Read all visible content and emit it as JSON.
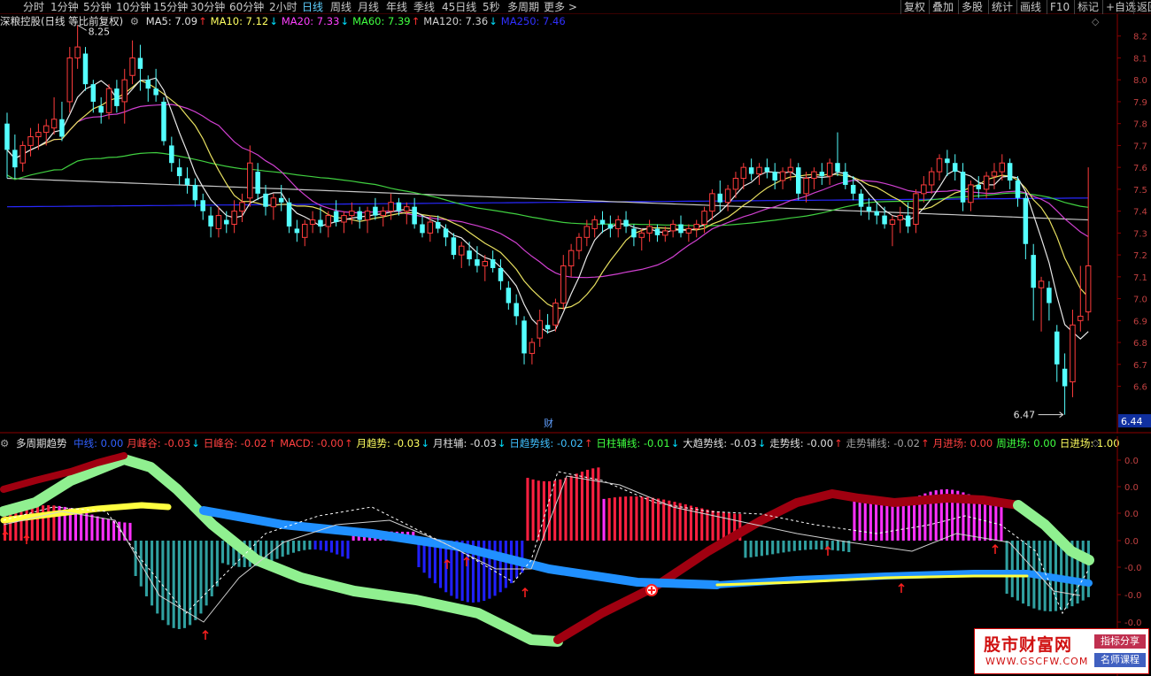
{
  "toolbar": {
    "periods": [
      "分时",
      "1分钟",
      "5分钟",
      "10分钟",
      "15分钟",
      "30分钟",
      "60分钟",
      "2小时",
      "日线",
      "周线",
      "月线",
      "年线",
      "季线",
      "45日线",
      "5秒",
      "多周期",
      "更多 >"
    ],
    "active_period": "日线",
    "right_buttons": [
      "复权",
      "叠加",
      "多股",
      "统计",
      "画线",
      "F10",
      "标记",
      "+自选",
      "返回"
    ]
  },
  "main_legend": {
    "title": "深粮控股(日线 等比前复权)",
    "items": [
      {
        "label": "MA5: 7.09",
        "arrow": "↑",
        "color": "#e0e0e0"
      },
      {
        "label": "MA10: 7.12",
        "arrow": "↓",
        "color": "#ffff60"
      },
      {
        "label": "MA20: 7.33",
        "arrow": "↓",
        "color": "#ff40ff"
      },
      {
        "label": "MA60: 7.39",
        "arrow": "↑",
        "color": "#40ff40"
      },
      {
        "label": "MA120: 7.36",
        "arrow": "↓",
        "color": "#d0d0d0"
      },
      {
        "label": "MA250: 7.46",
        "arrow": "",
        "color": "#3030ff"
      }
    ]
  },
  "price_axis": {
    "ticks": [
      "8.2",
      "8.1",
      "8.0",
      "7.9",
      "7.8",
      "7.7",
      "7.6",
      "7.5",
      "7.4",
      "7.3",
      "7.2",
      "7.1",
      "7.0",
      "6.9",
      "6.8",
      "6.7",
      "6.6"
    ],
    "current_price": "6.44",
    "high_label": "8.25",
    "low_label": "6.47",
    "marker": "财"
  },
  "indicator_legend": {
    "title": "多周期趋势",
    "items": [
      {
        "label": "中线: 0.00",
        "arrow": "",
        "color": "#3060ff"
      },
      {
        "label": "月峰谷: -0.03",
        "arrow": "↓",
        "color": "#ff4040"
      },
      {
        "label": "日峰谷: -0.02",
        "arrow": "↑",
        "color": "#ff4040"
      },
      {
        "label": "MACD: -0.00",
        "arrow": "↑",
        "color": "#ff4040"
      },
      {
        "label": "月趋势: -0.03",
        "arrow": "↓",
        "color": "#ffff60"
      },
      {
        "label": "月柱辅: -0.03",
        "arrow": "↓",
        "color": "#e0e0e0"
      },
      {
        "label": "日趋势线: -0.02",
        "arrow": "↑",
        "color": "#40c0ff"
      },
      {
        "label": "日柱辅线: -0.01",
        "arrow": "↓",
        "color": "#40ff40"
      },
      {
        "label": "大趋势线: -0.03",
        "arrow": "↓",
        "color": "#e0e0e0"
      },
      {
        "label": "走势线: -0.00",
        "arrow": "↑",
        "color": "#e0e0e0"
      },
      {
        "label": "走势辅线: -0.02",
        "arrow": "↑",
        "color": "#a0a0a0"
      },
      {
        "label": "月进场: 0.00",
        "arrow": "",
        "color": "#ff4040"
      },
      {
        "label": "周进场: 0.00",
        "arrow": "",
        "color": "#40ff40"
      },
      {
        "label": "日进场: 1.00",
        "arrow": "",
        "color": "#ffff60"
      }
    ]
  },
  "indicator_axis": {
    "ticks": [
      "0.0",
      "0.0",
      "0.0",
      "0.0",
      "-0.0",
      "-0.0",
      "-0.0",
      "-0.0"
    ]
  },
  "watermark": {
    "main": "股市财富网",
    "url": "WWW.GSCFW.COM",
    "tag1": "指标分享",
    "tag2": "名师课程"
  },
  "colors": {
    "up_candle": "#ff3c3c",
    "down_candle": "#54ffff",
    "ma5": "#e8e8e8",
    "ma10": "#e8e060",
    "ma20": "#d040d0",
    "ma60": "#40d040",
    "ma120": "#c8c8c8",
    "ma250": "#2828ff"
  },
  "chart_data": {
    "type": "candlestick",
    "ylim": [
      6.4,
      8.3
    ],
    "candles": [
      [
        7.8,
        7.85,
        7.55,
        7.68
      ],
      [
        7.68,
        7.75,
        7.55,
        7.6
      ],
      [
        7.62,
        7.72,
        7.58,
        7.7
      ],
      [
        7.7,
        7.78,
        7.65,
        7.74
      ],
      [
        7.74,
        7.8,
        7.68,
        7.76
      ],
      [
        7.76,
        7.82,
        7.7,
        7.79
      ],
      [
        7.78,
        7.92,
        7.75,
        7.82
      ],
      [
        7.82,
        7.9,
        7.72,
        7.74
      ],
      [
        7.9,
        8.15,
        7.85,
        8.1
      ],
      [
        8.1,
        8.25,
        8.05,
        8.15
      ],
      [
        8.12,
        8.15,
        7.95,
        7.98
      ],
      [
        7.98,
        8.0,
        7.85,
        7.9
      ],
      [
        7.88,
        7.92,
        7.8,
        7.85
      ],
      [
        7.85,
        7.98,
        7.82,
        7.96
      ],
      [
        7.96,
        8.0,
        7.85,
        7.88
      ],
      [
        7.9,
        8.05,
        7.8,
        8.0
      ],
      [
        8.02,
        8.18,
        7.98,
        8.1
      ],
      [
        8.1,
        8.16,
        7.95,
        8.05
      ],
      [
        8.0,
        8.02,
        7.9,
        7.96
      ],
      [
        7.96,
        8.05,
        7.9,
        7.93
      ],
      [
        7.9,
        7.92,
        7.7,
        7.72
      ],
      [
        7.7,
        7.74,
        7.58,
        7.62
      ],
      [
        7.6,
        7.64,
        7.52,
        7.56
      ],
      [
        7.55,
        7.6,
        7.48,
        7.52
      ],
      [
        7.52,
        7.55,
        7.42,
        7.45
      ],
      [
        7.45,
        7.48,
        7.36,
        7.4
      ],
      [
        7.38,
        7.42,
        7.28,
        7.33
      ],
      [
        7.32,
        7.42,
        7.28,
        7.38
      ],
      [
        7.36,
        7.4,
        7.3,
        7.34
      ],
      [
        7.34,
        7.45,
        7.3,
        7.4
      ],
      [
        7.4,
        7.48,
        7.35,
        7.44
      ],
      [
        7.46,
        7.7,
        7.42,
        7.62
      ],
      [
        7.58,
        7.62,
        7.45,
        7.48
      ],
      [
        7.48,
        7.52,
        7.38,
        7.42
      ],
      [
        7.42,
        7.48,
        7.36,
        7.46
      ],
      [
        7.46,
        7.52,
        7.4,
        7.44
      ],
      [
        7.44,
        7.46,
        7.3,
        7.33
      ],
      [
        7.32,
        7.36,
        7.26,
        7.3
      ],
      [
        7.28,
        7.36,
        7.24,
        7.34
      ],
      [
        7.34,
        7.4,
        7.3,
        7.36
      ],
      [
        7.36,
        7.42,
        7.3,
        7.33
      ],
      [
        7.33,
        7.4,
        7.28,
        7.38
      ],
      [
        7.4,
        7.45,
        7.33,
        7.35
      ],
      [
        7.35,
        7.4,
        7.3,
        7.38
      ],
      [
        7.38,
        7.44,
        7.34,
        7.4
      ],
      [
        7.4,
        7.42,
        7.32,
        7.36
      ],
      [
        7.36,
        7.42,
        7.3,
        7.4
      ],
      [
        7.42,
        7.46,
        7.36,
        7.38
      ],
      [
        7.38,
        7.42,
        7.33,
        7.4
      ],
      [
        7.4,
        7.48,
        7.36,
        7.44
      ],
      [
        7.44,
        7.46,
        7.38,
        7.4
      ],
      [
        7.4,
        7.44,
        7.34,
        7.42
      ],
      [
        7.42,
        7.46,
        7.32,
        7.34
      ],
      [
        7.34,
        7.38,
        7.28,
        7.3
      ],
      [
        7.3,
        7.38,
        7.26,
        7.35
      ],
      [
        7.35,
        7.38,
        7.3,
        7.32
      ],
      [
        7.32,
        7.34,
        7.24,
        7.28
      ],
      [
        7.28,
        7.3,
        7.18,
        7.2
      ],
      [
        7.2,
        7.26,
        7.14,
        7.24
      ],
      [
        7.22,
        7.26,
        7.15,
        7.18
      ],
      [
        7.18,
        7.24,
        7.12,
        7.15
      ],
      [
        7.15,
        7.2,
        7.08,
        7.17
      ],
      [
        7.18,
        7.22,
        7.12,
        7.14
      ],
      [
        7.14,
        7.18,
        7.04,
        7.08
      ],
      [
        7.05,
        7.08,
        6.95,
        6.98
      ],
      [
        6.98,
        7.02,
        6.88,
        6.92
      ],
      [
        6.9,
        6.92,
        6.7,
        6.75
      ],
      [
        6.75,
        6.82,
        6.7,
        6.8
      ],
      [
        6.82,
        6.95,
        6.78,
        6.9
      ],
      [
        6.88,
        6.93,
        6.84,
        6.86
      ],
      [
        6.88,
        7.0,
        6.85,
        6.98
      ],
      [
        6.98,
        7.2,
        6.95,
        7.15
      ],
      [
        7.15,
        7.25,
        7.1,
        7.22
      ],
      [
        7.22,
        7.3,
        7.18,
        7.28
      ],
      [
        7.28,
        7.36,
        7.24,
        7.33
      ],
      [
        7.32,
        7.38,
        7.28,
        7.36
      ],
      [
        7.36,
        7.4,
        7.3,
        7.34
      ],
      [
        7.34,
        7.38,
        7.28,
        7.32
      ],
      [
        7.32,
        7.38,
        7.28,
        7.36
      ],
      [
        7.36,
        7.4,
        7.3,
        7.33
      ],
      [
        7.32,
        7.34,
        7.24,
        7.28
      ],
      [
        7.28,
        7.32,
        7.22,
        7.3
      ],
      [
        7.3,
        7.36,
        7.26,
        7.33
      ],
      [
        7.32,
        7.34,
        7.26,
        7.29
      ],
      [
        7.29,
        7.33,
        7.26,
        7.31
      ],
      [
        7.31,
        7.36,
        7.28,
        7.34
      ],
      [
        7.34,
        7.38,
        7.28,
        7.3
      ],
      [
        7.3,
        7.34,
        7.26,
        7.32
      ],
      [
        7.32,
        7.36,
        7.28,
        7.34
      ],
      [
        7.34,
        7.42,
        7.3,
        7.4
      ],
      [
        7.4,
        7.5,
        7.36,
        7.48
      ],
      [
        7.48,
        7.54,
        7.4,
        7.44
      ],
      [
        7.44,
        7.52,
        7.4,
        7.5
      ],
      [
        7.5,
        7.58,
        7.46,
        7.55
      ],
      [
        7.55,
        7.62,
        7.5,
        7.6
      ],
      [
        7.6,
        7.64,
        7.54,
        7.57
      ],
      [
        7.57,
        7.62,
        7.52,
        7.6
      ],
      [
        7.6,
        7.64,
        7.55,
        7.58
      ],
      [
        7.58,
        7.62,
        7.5,
        7.54
      ],
      [
        7.54,
        7.6,
        7.5,
        7.58
      ],
      [
        7.58,
        7.64,
        7.54,
        7.6
      ],
      [
        7.6,
        7.62,
        7.45,
        7.48
      ],
      [
        7.48,
        7.58,
        7.44,
        7.55
      ],
      [
        7.55,
        7.6,
        7.5,
        7.58
      ],
      [
        7.58,
        7.62,
        7.52,
        7.56
      ],
      [
        7.56,
        7.64,
        7.52,
        7.62
      ],
      [
        7.62,
        7.76,
        7.56,
        7.58
      ],
      [
        7.58,
        7.62,
        7.5,
        7.52
      ],
      [
        7.52,
        7.56,
        7.45,
        7.48
      ],
      [
        7.48,
        7.5,
        7.38,
        7.42
      ],
      [
        7.42,
        7.46,
        7.36,
        7.4
      ],
      [
        7.4,
        7.44,
        7.34,
        7.38
      ],
      [
        7.38,
        7.42,
        7.32,
        7.34
      ],
      [
        7.34,
        7.38,
        7.24,
        7.36
      ],
      [
        7.36,
        7.42,
        7.3,
        7.38
      ],
      [
        7.38,
        7.44,
        7.3,
        7.33
      ],
      [
        7.34,
        7.5,
        7.3,
        7.48
      ],
      [
        7.48,
        7.56,
        7.44,
        7.52
      ],
      [
        7.52,
        7.6,
        7.48,
        7.58
      ],
      [
        7.58,
        7.66,
        7.54,
        7.64
      ],
      [
        7.64,
        7.68,
        7.56,
        7.62
      ],
      [
        7.62,
        7.66,
        7.54,
        7.58
      ],
      [
        7.58,
        7.62,
        7.4,
        7.44
      ],
      [
        7.44,
        7.54,
        7.4,
        7.52
      ],
      [
        7.52,
        7.56,
        7.46,
        7.5
      ],
      [
        7.5,
        7.58,
        7.46,
        7.56
      ],
      [
        7.56,
        7.62,
        7.5,
        7.58
      ],
      [
        7.58,
        7.66,
        7.54,
        7.62
      ],
      [
        7.62,
        7.64,
        7.5,
        7.54
      ],
      [
        7.54,
        7.56,
        7.42,
        7.46
      ],
      [
        7.46,
        7.48,
        7.18,
        7.25
      ],
      [
        7.2,
        7.25,
        6.9,
        7.05
      ],
      [
        7.05,
        7.1,
        6.85,
        7.08
      ],
      [
        7.05,
        7.08,
        6.9,
        6.98
      ],
      [
        6.85,
        6.88,
        6.62,
        6.7
      ],
      [
        6.68,
        6.75,
        6.47,
        6.6
      ],
      [
        6.62,
        6.95,
        6.55,
        6.88
      ],
      [
        6.9,
        7.15,
        6.85,
        6.92
      ],
      [
        6.94,
        7.6,
        6.9,
        7.15
      ]
    ]
  }
}
